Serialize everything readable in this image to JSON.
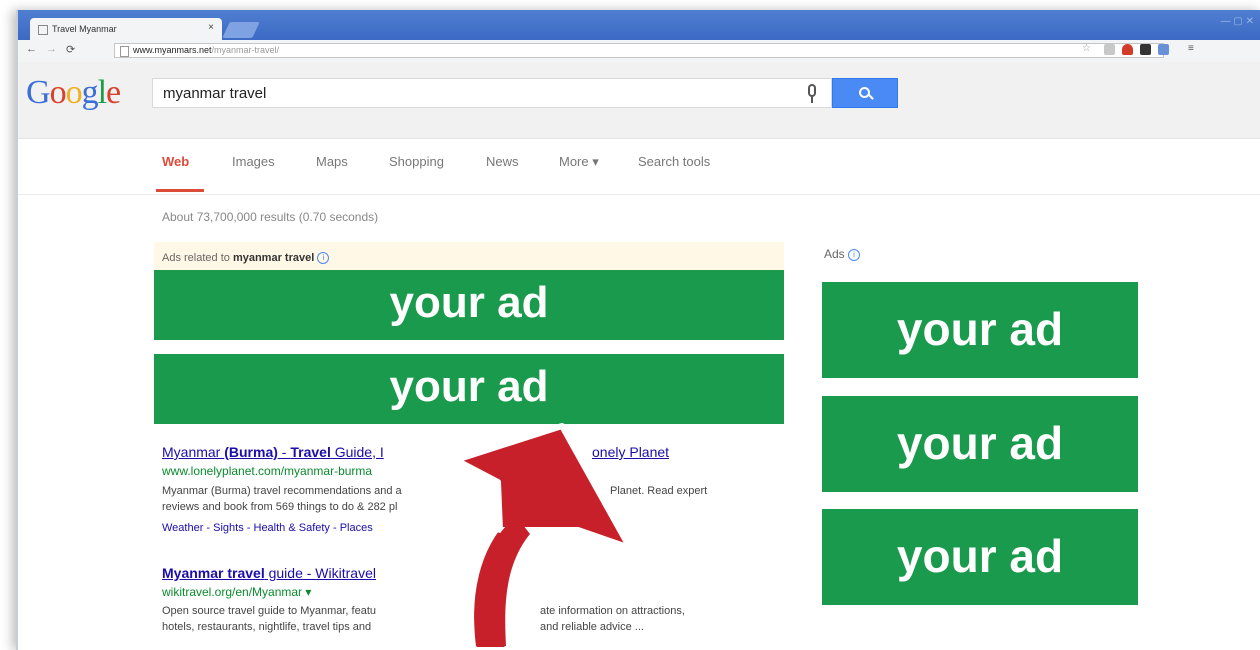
{
  "browser": {
    "tab_title": "Travel Myanmar",
    "tab_close": "×",
    "url_host": "www.myanmars.net",
    "url_path": "/myanmar-travel/",
    "window_controls": "— ▢ ✕"
  },
  "google": {
    "logo": [
      "G",
      "o",
      "o",
      "g",
      "l",
      "e"
    ],
    "logo_colors": [
      "#3a6fd8",
      "#d9412d",
      "#f2b01e",
      "#3a6fd8",
      "#1c9e48",
      "#d9412d"
    ],
    "query": "myanmar travel",
    "nav": [
      "Web",
      "Images",
      "Maps",
      "Shopping",
      "News",
      "More ▾",
      "Search tools"
    ],
    "stats": "About 73,700,000 results (0.70 seconds)"
  },
  "ads": {
    "top_label_prefix": "Ads related to ",
    "top_label_query": "myanmar travel",
    "side_label": "Ads",
    "info_icon": "i",
    "banner_text": "your  ad",
    "banner_color": "#1a9a4c"
  },
  "results": [
    {
      "title_a": "Myanmar ",
      "title_b": "(Burma)",
      "title_c": " - ",
      "title_d": "Travel",
      "title_e": " Guide, I",
      "title_tail": "onely Planet",
      "url": "www.lonelyplanet.com/myanmar-burma",
      "snippet1a": "Myanmar (Burma) travel recommendations and a",
      "snippet1b": "Planet. Read expert",
      "snippet2": "reviews and book from 569 things to do & 282 pl",
      "links": "Weather - Sights - Health & Safety - Places"
    },
    {
      "title_a": "Myanmar travel",
      "title_b": " guide - Wikitravel",
      "url": "wikitravel.org/en/Myanmar ▾",
      "snippet1a": "Open source travel guide to Myanmar, featu",
      "snippet1b": "ate information on attractions,",
      "snippet2a": "hotels, restaurants, nightlife, travel tips and",
      "snippet2b": "and reliable advice ..."
    }
  ]
}
